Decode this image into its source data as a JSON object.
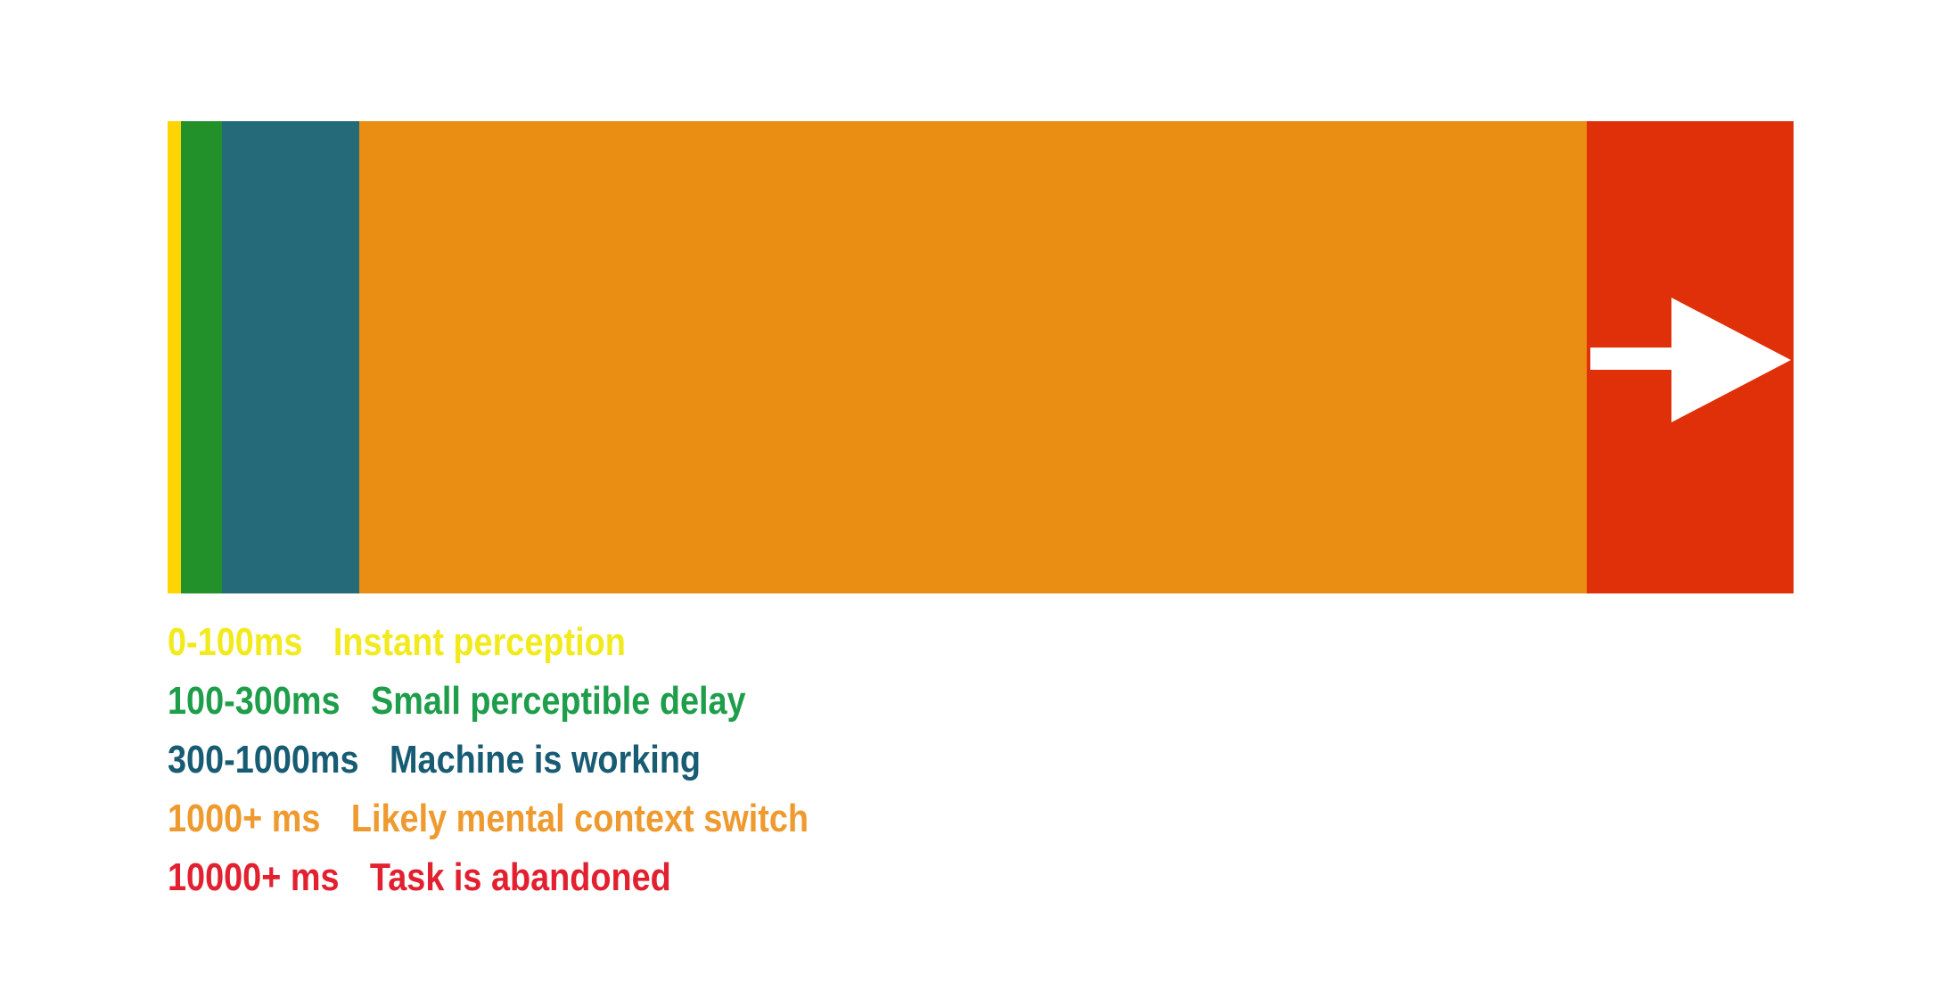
{
  "colors": {
    "bar_yellow": "#FED402",
    "bar_green": "#22912A",
    "bar_teal": "#256A78",
    "bar_orange": "#E98D13",
    "bar_red": "#E0300A",
    "arrow": "#FFFFFF"
  },
  "legend": [
    {
      "range": "0-100ms",
      "label": "Instant perception",
      "color": "#F2EA1C"
    },
    {
      "range": "100-300ms",
      "label": "Small perceptible delay",
      "color": "#1E9E4A"
    },
    {
      "range": "300-1000ms",
      "label": "Machine is working",
      "color": "#185C74"
    },
    {
      "range": "1000+ ms",
      "label": "Likely mental context switch",
      "color": "#EE9A2E"
    },
    {
      "range": "10000+ ms",
      "label": "Task is abandoned",
      "color": "#E2202F"
    }
  ],
  "icons": {
    "continuation": "arrow-right-icon"
  }
}
